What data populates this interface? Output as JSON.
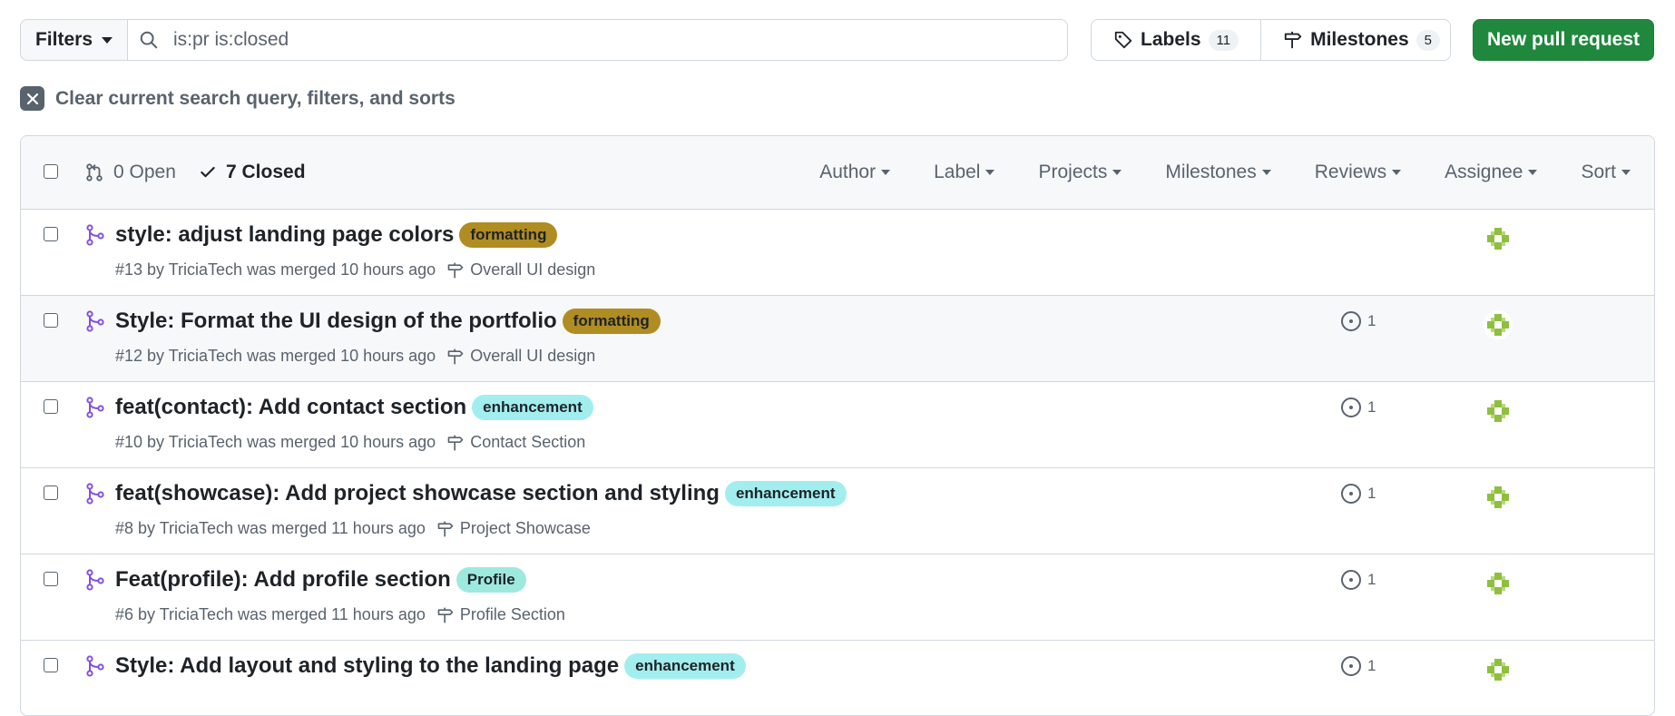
{
  "toolbar": {
    "filters_label": "Filters",
    "search_value": "is:pr is:closed",
    "labels_label": "Labels",
    "labels_count": "11",
    "milestones_label": "Milestones",
    "milestones_count": "5",
    "new_pr_label": "New pull request"
  },
  "clear_query_label": "Clear current search query, filters, and sorts",
  "list_header": {
    "open_label": "0 Open",
    "closed_label": "7 Closed",
    "filters": [
      "Author",
      "Label",
      "Projects",
      "Milestones",
      "Reviews",
      "Assignee",
      "Sort"
    ]
  },
  "pull_requests": [
    {
      "title": "style: adjust landing page colors",
      "label": "formatting",
      "label_bg": "#b08d22",
      "label_fg": "#1f2328",
      "meta": "#13 by TriciaTech was merged 10 hours ago",
      "milestone": "Overall UI design",
      "reviews": ""
    },
    {
      "title": "Style: Format the UI design of the portfolio",
      "label": "formatting",
      "label_bg": "#b08d22",
      "label_fg": "#1f2328",
      "meta": "#12 by TriciaTech was merged 10 hours ago",
      "milestone": "Overall UI design",
      "reviews": "1"
    },
    {
      "title": "feat(contact): Add contact section",
      "label": "enhancement",
      "label_bg": "#a2eeef",
      "label_fg": "#1f2328",
      "meta": "#10 by TriciaTech was merged 10 hours ago",
      "milestone": "Contact Section",
      "reviews": "1"
    },
    {
      "title": "feat(showcase): Add project showcase section and styling",
      "label": "enhancement",
      "label_bg": "#a2eeef",
      "label_fg": "#1f2328",
      "meta": "#8 by TriciaTech was merged 11 hours ago",
      "milestone": "Project Showcase",
      "reviews": "1"
    },
    {
      "title": "Feat(profile): Add profile section",
      "label": "Profile",
      "label_bg": "#9ee9de",
      "label_fg": "#1f2328",
      "meta": "#6 by TriciaTech was merged 11 hours ago",
      "milestone": "Profile Section",
      "reviews": "1"
    },
    {
      "title": "Style: Add layout and styling to the landing page",
      "label": "enhancement",
      "label_bg": "#a2eeef",
      "label_fg": "#1f2328",
      "meta": "",
      "milestone": "",
      "reviews": "1"
    }
  ],
  "colors": {
    "merged_icon": "#8250df",
    "primary_button": "#1f883d",
    "avatar": "#8fbf3f"
  }
}
